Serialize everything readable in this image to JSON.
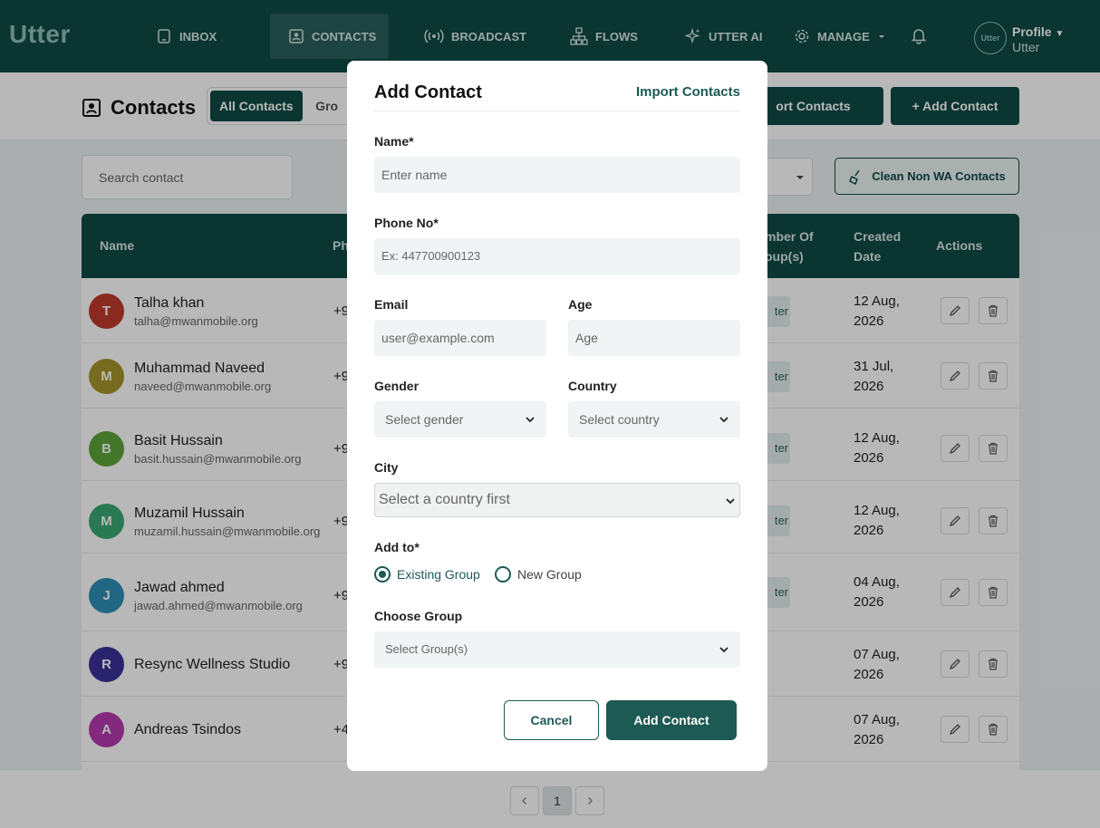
{
  "nav": {
    "logo": "Utter",
    "items": [
      {
        "label": "INBOX",
        "icon": "tablet-icon"
      },
      {
        "label": "CONTACTS",
        "icon": "contact-card-icon",
        "active": true
      },
      {
        "label": "BROADCAST",
        "icon": "broadcast-icon"
      },
      {
        "label": "FLOWS",
        "icon": "flow-icon"
      },
      {
        "label": "UTTER AI",
        "icon": "sparkle-icon"
      },
      {
        "label": "MANAGE",
        "icon": "gear-icon"
      }
    ],
    "avatar_text": "Utter",
    "profile_label": "Profile",
    "profile_sub": "Utter"
  },
  "page": {
    "title": "Contacts",
    "tabs": [
      "All Contacts",
      "Gro"
    ],
    "import_label": "ort Contacts",
    "add_label": "+ Add Contact",
    "search_placeholder": "Search contact",
    "clean_label": "Clean Non WA Contacts"
  },
  "table": {
    "headers": {
      "name": "Name",
      "phone": "Ph",
      "groups": "mber Of\noup(s)",
      "created": "Created\nDate",
      "actions": "Actions"
    },
    "rows": [
      {
        "initial": "T",
        "color": "#c0392b",
        "name": "Talha khan",
        "email": "talha@mwanmobile.org",
        "phone": "+9",
        "badge": "ter",
        "date": "12 Aug,\n2026"
      },
      {
        "initial": "M",
        "color": "#a4952a",
        "name": "Muhammad Naveed",
        "email": "naveed@mwanmobile.org",
        "phone": "+9",
        "badge": "ter",
        "date": "31 Jul,\n2026"
      },
      {
        "initial": "B",
        "color": "#5ea43a",
        "name": "Basit Hussain",
        "email": "basit.hussain@mwanmobile.org",
        "phone": "+9",
        "badge": "ter",
        "date": "12 Aug,\n2026"
      },
      {
        "initial": "M",
        "color": "#3aa873",
        "name": "Muzamil Hussain",
        "email": "muzamil.hussain@mwanmobile.org",
        "phone": "+9",
        "badge": "ter",
        "date": "12 Aug,\n2026"
      },
      {
        "initial": "J",
        "color": "#2f8fb8",
        "name": "Jawad ahmed",
        "email": "jawad.ahmed@mwanmobile.org",
        "phone": "+9",
        "badge": "ter",
        "date": "04 Aug,\n2026"
      },
      {
        "initial": "R",
        "color": "#3b3399",
        "name": "Resync Wellness Studio",
        "email": "",
        "phone": "+9",
        "badge": "",
        "date": "07 Aug,\n2026"
      },
      {
        "initial": "A",
        "color": "#b63aaf",
        "name": "Andreas Tsindos",
        "email": "",
        "phone": "+4",
        "badge": "",
        "date": "07 Aug,\n2026"
      }
    ]
  },
  "pagination": {
    "current": "1"
  },
  "modal": {
    "title": "Add Contact",
    "import_link": "Import Contacts",
    "name_label": "Name*",
    "name_placeholder": "Enter name",
    "phone_label": "Phone No*",
    "phone_placeholder": "Ex: 447700900123",
    "email_label": "Email",
    "email_placeholder": "user@example.com",
    "age_label": "Age",
    "age_placeholder": "Age",
    "gender_label": "Gender",
    "gender_placeholder": "Select gender",
    "country_label": "Country",
    "country_placeholder": "Select country",
    "city_label": "City",
    "city_placeholder": "Select a country first",
    "addto_label": "Add to*",
    "existing_group": "Existing Group",
    "new_group": "New Group",
    "choose_group_label": "Choose Group",
    "choose_group_placeholder": "Select Group(s)",
    "cancel": "Cancel",
    "submit": "Add Contact"
  },
  "colors": {
    "brand": "#0e4a45",
    "accent": "#1d5a54"
  }
}
